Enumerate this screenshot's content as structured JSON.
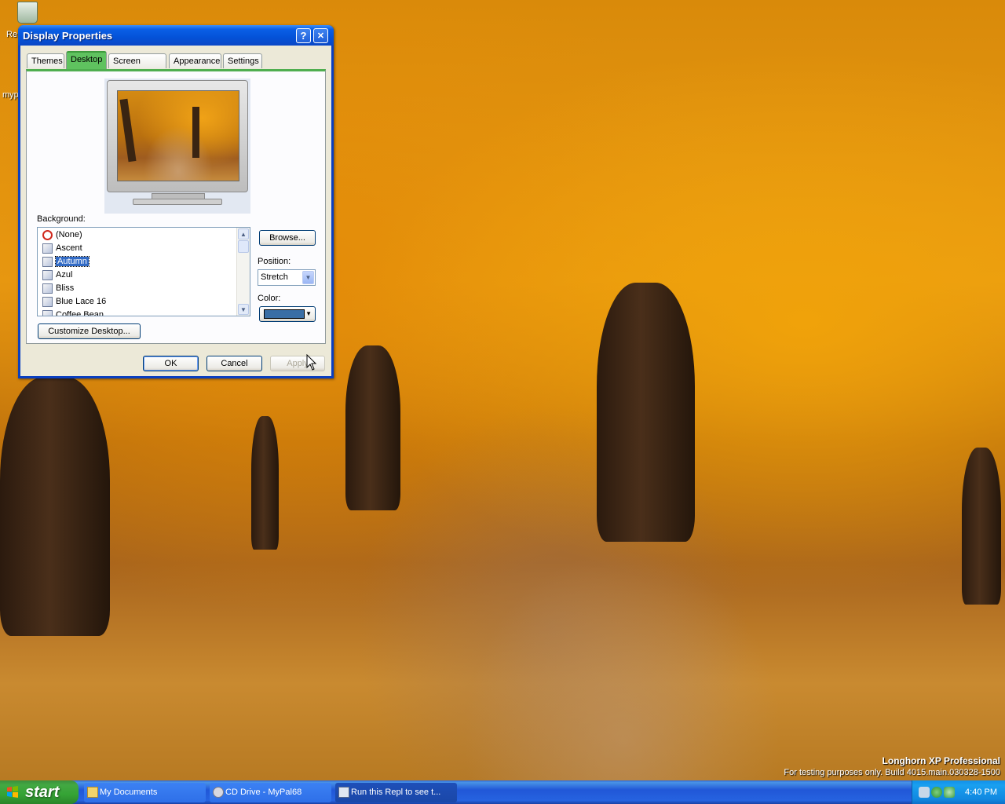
{
  "desktop": {
    "icons": [
      {
        "label": "Re",
        "name": "recycle-bin"
      },
      {
        "label": "myp",
        "name": "mypal"
      }
    ],
    "watermark": {
      "line1": "Longhorn XP Professional",
      "line2": "For testing purposes only. Build 4015.main.030328-1500"
    }
  },
  "dialog": {
    "title": "Display Properties",
    "help_glyph": "?",
    "close_glyph": "✕",
    "tabs": [
      {
        "label": "Themes",
        "active": false
      },
      {
        "label": "Desktop",
        "active": true
      },
      {
        "label": "Screen Saver",
        "active": false
      },
      {
        "label": "Appearance",
        "active": false
      },
      {
        "label": "Settings",
        "active": false
      }
    ],
    "background_label": "Background:",
    "background_items": [
      {
        "label": "(None)",
        "icon": "none-icon",
        "selected": false
      },
      {
        "label": "Ascent",
        "icon": "image-file-icon",
        "selected": false
      },
      {
        "label": "Autumn",
        "icon": "image-file-icon",
        "selected": true
      },
      {
        "label": "Azul",
        "icon": "image-file-icon",
        "selected": false
      },
      {
        "label": "Bliss",
        "icon": "image-file-icon",
        "selected": false
      },
      {
        "label": "Blue Lace 16",
        "icon": "image-file-icon",
        "selected": false
      },
      {
        "label": "Coffee Bean",
        "icon": "image-file-icon",
        "selected": false
      }
    ],
    "browse_label": "Browse...",
    "position_label": "Position:",
    "position_value": "Stretch",
    "color_label": "Color:",
    "color_value": "#3a6ea5",
    "customize_label": "Customize Desktop...",
    "ok_label": "OK",
    "cancel_label": "Cancel",
    "apply_label": "Apply"
  },
  "taskbar": {
    "start_label": "start",
    "tasks": [
      {
        "label": "My Documents"
      },
      {
        "label": "CD Drive - MyPal68"
      },
      {
        "label": "Run this Repl to see t..."
      }
    ],
    "clock": "4:40 PM"
  }
}
